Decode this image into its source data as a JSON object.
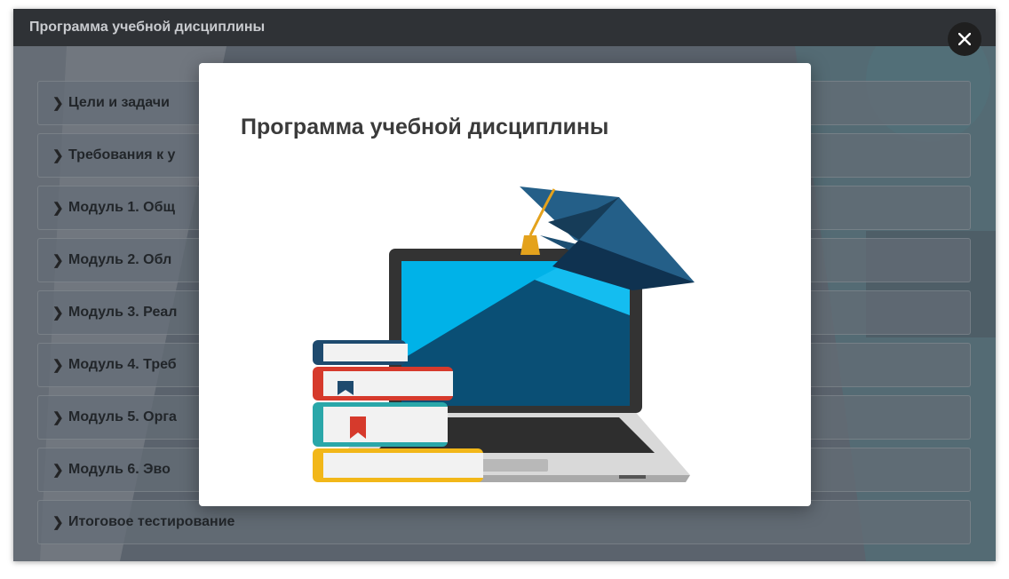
{
  "window": {
    "title": "Программа учебной дисциплины"
  },
  "accordion": {
    "items": [
      {
        "label": "Цели и задачи"
      },
      {
        "label": "Требования к у"
      },
      {
        "label": "Модуль 1. Общ"
      },
      {
        "label": "Модуль 2. Обл"
      },
      {
        "label": "Модуль 3. Реал"
      },
      {
        "label": "Модуль 4. Треб"
      },
      {
        "label": "Модуль 5. Орга"
      },
      {
        "label": "Модуль 6. Эво"
      },
      {
        "label": "Итоговое тестирование"
      }
    ]
  },
  "modal": {
    "title": "Программа учебной дисциплины",
    "illustration": "laptop-books-graduation-cap"
  },
  "close_icon": "close-icon",
  "colors": {
    "titlebar": "#2f3236",
    "accordion_item": "#7f8992",
    "close_button": "#1f1f1f",
    "cap": "#1d4f73",
    "screen": "#00b2e8"
  }
}
